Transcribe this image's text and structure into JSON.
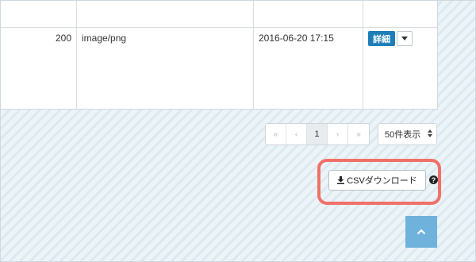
{
  "table": {
    "row": {
      "size": "200",
      "type": "image/png",
      "date": "2016-06-20 17:15",
      "detail_label": "詳細"
    }
  },
  "pagination": {
    "first": "«",
    "prev": "‹",
    "current": "1",
    "next": "›",
    "last": "»"
  },
  "per_page": {
    "selected": "50件表示"
  },
  "csv": {
    "label": "CSVダウンロード",
    "help": "?"
  },
  "colors": {
    "accent": "#1e7fb8",
    "highlight": "#f07167",
    "scroll_top": "#6fb3dc"
  },
  "icons": [
    "download-icon",
    "question-circle-icon",
    "chevron-up-icon",
    "caret-down-icon"
  ]
}
